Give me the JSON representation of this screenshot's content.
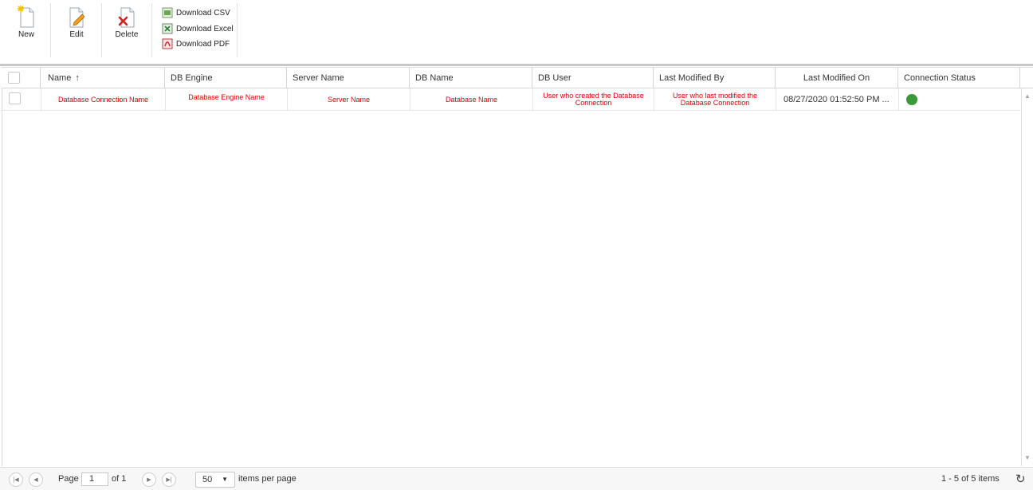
{
  "toolbar": {
    "new_label": "New",
    "edit_label": "Edit",
    "delete_label": "Delete",
    "download_csv": "Download CSV",
    "download_excel": "Download Excel",
    "download_pdf": "Download PDF"
  },
  "grid": {
    "columns": [
      "Name",
      "DB Engine",
      "Server Name",
      "DB Name",
      "DB User",
      "Last Modified By",
      "Last Modified On",
      "Connection Status"
    ],
    "sort_indicator": "↑",
    "rows": [
      {
        "name": "Database Connection Name",
        "db_engine": "Database Engine Name",
        "server_name": "Server Name",
        "db_name": "Database Name",
        "db_user": "User who created the Database Connection",
        "last_modified_by": "User who last modified the Database Connection",
        "last_modified_on": "08/27/2020 01:52:50 PM ...",
        "connection_status": "connected",
        "status_color": "#3a9a3a"
      }
    ]
  },
  "pager": {
    "page_label": "Page",
    "page_value": "1",
    "of_label": "of 1",
    "page_size": "50",
    "items_per_page": "items per page",
    "summary": "1 - 5 of 5 items"
  },
  "colors": {
    "annotation_red": "#e00000",
    "status_green": "#3a9a3a"
  }
}
